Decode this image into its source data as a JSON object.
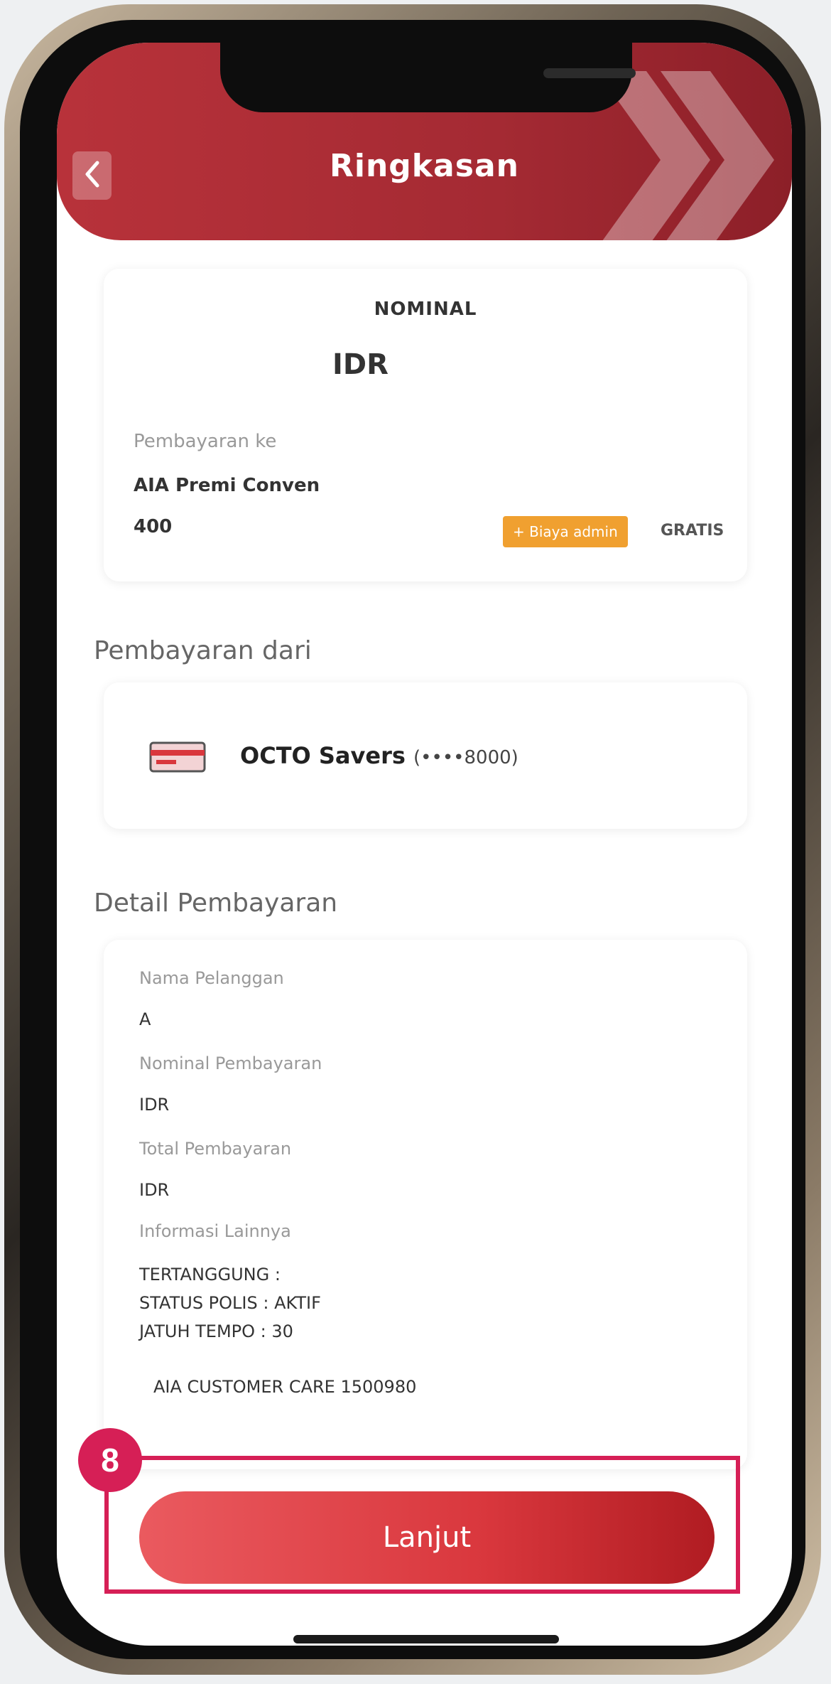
{
  "header": {
    "title": "Ringkasan",
    "back_icon": "chevron-left-icon"
  },
  "nominal_card": {
    "label": "NOMINAL",
    "amount": "IDR",
    "pay_to_label": "Pembayaran ke",
    "pay_to_name": "AIA Premi Conven",
    "pay_to_number": "400",
    "admin_fee_label": "+ Biaya admin",
    "admin_fee_value": "GRATIS"
  },
  "payment_from": {
    "section_title": "Pembayaran dari",
    "account_icon": "card-icon",
    "account_name": "OCTO Savers",
    "account_masked": "(••••8000)"
  },
  "payment_detail": {
    "section_title": "Detail Pembayaran",
    "customer_name_label": "Nama Pelanggan",
    "customer_name_value": "A",
    "nominal_label": "Nominal Pembayaran",
    "nominal_value": "IDR",
    "total_label": "Total Pembayaran",
    "total_value": "IDR",
    "other_info_label": "Informasi Lainnya",
    "other_info_value": "TERTANGGUNG :\nSTATUS POLIS : AKTIF\nJATUH TEMPO : 30",
    "customer_care": "AIA CUSTOMER CARE 1500980"
  },
  "annotation": {
    "step_number": "8",
    "highlight_color": "#d61f56"
  },
  "actions": {
    "continue_label": "Lanjut"
  },
  "colors": {
    "brand_red": "#b8323a",
    "button_red": "#d9373d",
    "badge_orange": "#f0a030"
  }
}
